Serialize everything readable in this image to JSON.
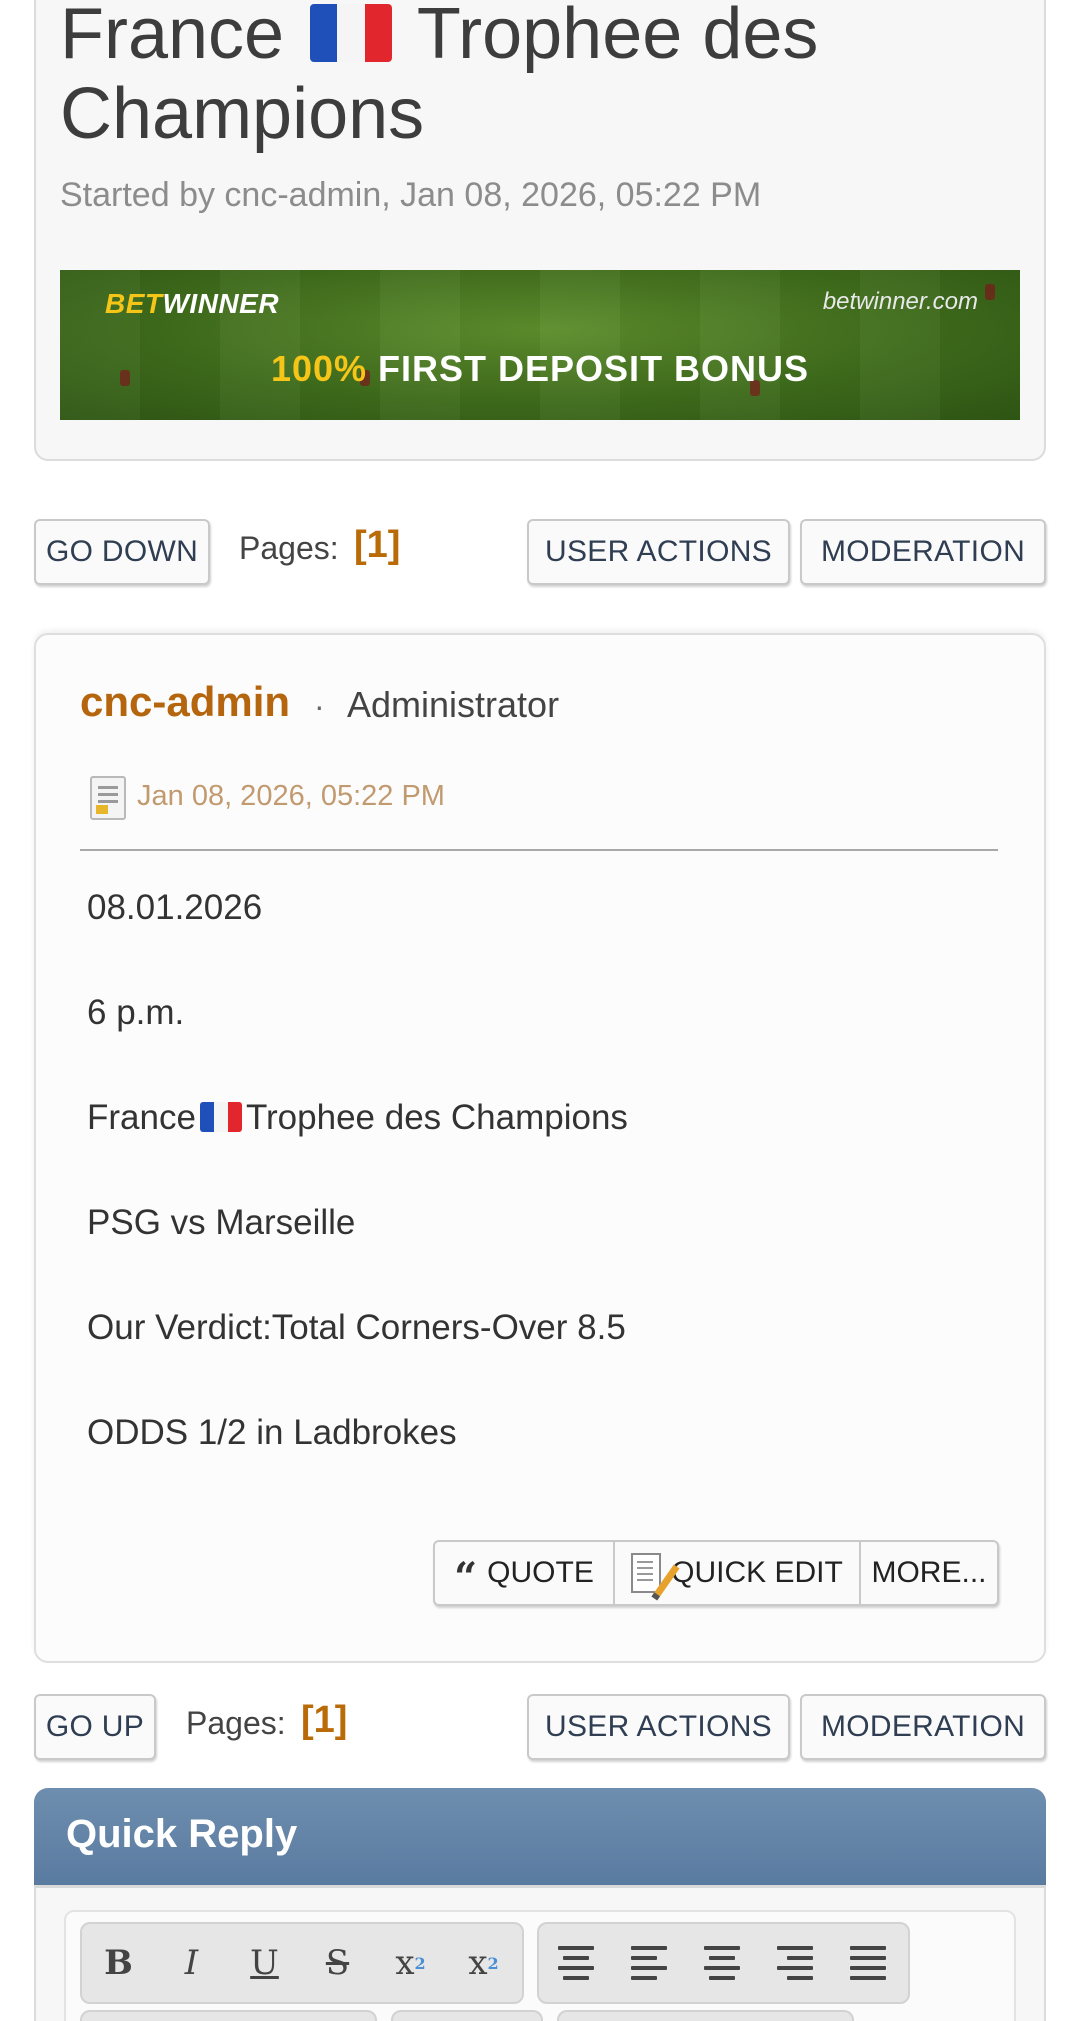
{
  "topic": {
    "title_prefix": "France",
    "title_suffix": "Trophee des",
    "title_line2": "Champions",
    "meta": "Started by cnc-admin, Jan 08, 2026, 05:22 PM"
  },
  "banner": {
    "brand_bet": "BET",
    "brand_winner": "WINNER",
    "site": "betwinner.com",
    "offer_pct": "100%",
    "offer_text": "FIRST DEPOSIT BONUS",
    "colors": {
      "accent": "#f5c518",
      "field": "#4a7a22"
    }
  },
  "nav_top": {
    "go_label": "GO DOWN",
    "pages_label": "Pages:",
    "page_current": "[1]",
    "user_actions": "USER ACTIONS",
    "moderation": "MODERATION"
  },
  "post": {
    "author": "cnc-admin",
    "separator": "·",
    "role": "Administrator",
    "date": "Jan 08, 2026, 05:22 PM",
    "lines": {
      "l1": "08.01.2026",
      "l2": "6 p.m.",
      "l3a": "France",
      "l3b": "Trophee des Champions",
      "l4": "PSG vs Marseille",
      "l5": "Our Verdict:Total Corners-Over 8.5",
      "l6": "ODDS 1/2 in Ladbrokes"
    },
    "actions": {
      "quote": "QUOTE",
      "quick_edit": "QUICK EDIT",
      "more": "MORE..."
    }
  },
  "nav_bottom": {
    "go_label": "GO UP",
    "pages_label": "Pages:",
    "page_current": "[1]",
    "user_actions": "USER ACTIONS",
    "moderation": "MODERATION"
  },
  "quick_reply": {
    "title": "Quick Reply",
    "toolbar": {
      "bold": "B",
      "italic": "I",
      "underline": "U",
      "strike": "S",
      "superscript": "x",
      "subscript": "x"
    },
    "colors": {
      "header": "#6383a7"
    }
  },
  "icons": [
    "france-flag-icon",
    "document-icon",
    "quote-icon",
    "edit-icon",
    "align-center-icon",
    "align-left-icon",
    "align-right-icon",
    "justify-icon"
  ],
  "accent_color": "#b4650d"
}
